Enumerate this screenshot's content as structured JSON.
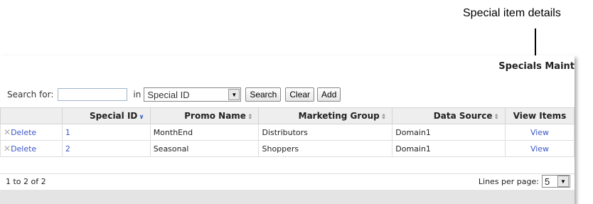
{
  "annotation": {
    "label": "Special item details"
  },
  "panel": {
    "title": "Specials Maint"
  },
  "search": {
    "label": "Search for:",
    "value": "",
    "in_label": "in",
    "field_selected": "Special ID",
    "buttons": {
      "search": "Search",
      "clear": "Clear",
      "add": "Add"
    }
  },
  "table": {
    "columns": {
      "special_id": "Special ID",
      "promo_name": "Promo Name",
      "marketing_group": "Marketing Group",
      "data_source": "Data Source",
      "view_items": "View Items"
    },
    "rows": [
      {
        "delete": "Delete",
        "special_id": "1",
        "promo_name": "MonthEnd",
        "marketing_group": "Distributors",
        "data_source": "Domain1",
        "view": "View"
      },
      {
        "delete": "Delete",
        "special_id": "2",
        "promo_name": "Seasonal",
        "marketing_group": "Shoppers",
        "data_source": "Domain1",
        "view": "View"
      }
    ]
  },
  "footer": {
    "count": "1 to 2 of 2",
    "lines_label": "Lines per page:",
    "lines_value": "5"
  },
  "icons": {
    "delete": "x-icon",
    "sort_active": "chevron-down-icon",
    "sort_inactive": "sort-updown-icon",
    "dropdown": "triangle-down-icon"
  },
  "colors": {
    "link": "#3a56c8",
    "header_bg": "#eeeeee",
    "band": "#e4e4e4"
  }
}
